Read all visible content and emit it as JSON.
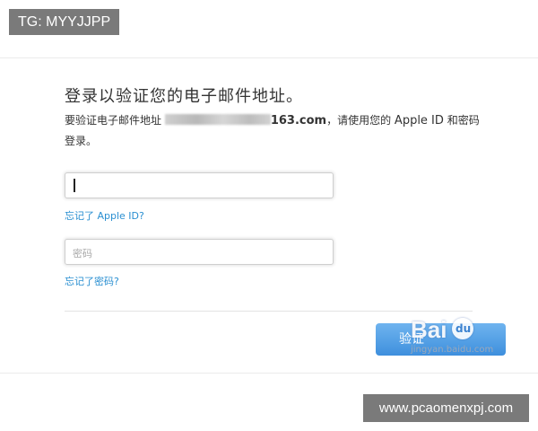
{
  "overlay": {
    "tg_label": "TG: MYYJJPP",
    "site_label": "www.pcaomenxpj.com"
  },
  "form": {
    "heading": "登录以验证您的电子邮件地址。",
    "description_prefix": "要验证电子邮件地址 ",
    "email_suffix": "163.com",
    "description_mid": "，请使用您的 ",
    "apple_id_text": "Apple ID",
    "description_end": " 和密码登录。",
    "apple_id_value": "",
    "forgot_apple_id": "忘记了 Apple ID?",
    "password_placeholder": "密码",
    "forgot_password": "忘记了密码?",
    "signin_label": "验证"
  },
  "watermark": {
    "logo_text": "Bai",
    "logo_du": "du",
    "sub_text": "jingyan.baidu.com"
  },
  "colors": {
    "link": "#2a8fd1",
    "button": "#4a9be6",
    "badge": "#7a7a7a"
  }
}
